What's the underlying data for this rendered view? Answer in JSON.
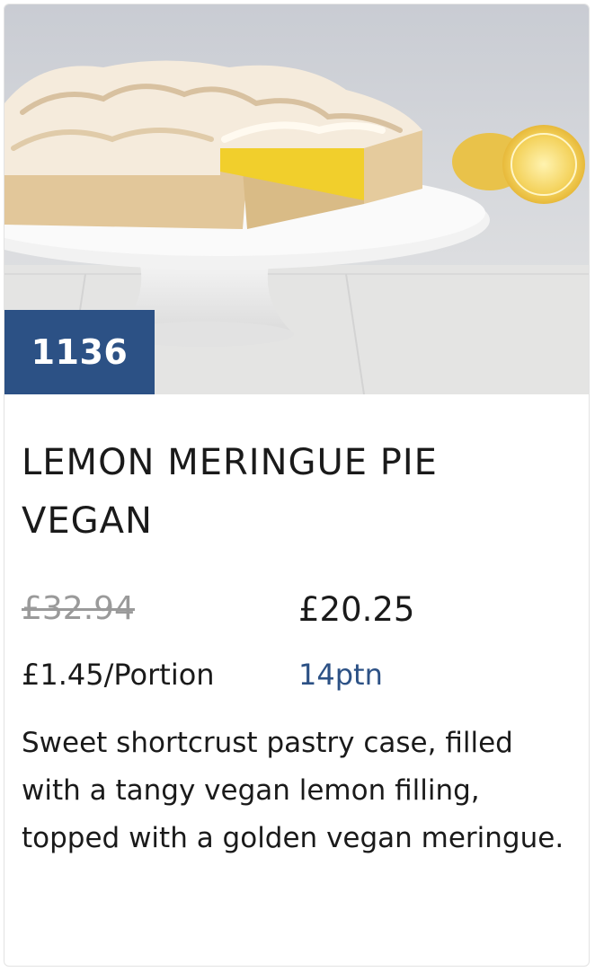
{
  "product": {
    "code": "1136",
    "title": "LEMON MERINGUE PIE VEGAN",
    "image_alt": "Lemon meringue pie on a white cake stand with lemon halves",
    "price_old": "£32.94",
    "price_new": "£20.25",
    "price_per_portion": "£1.45/Portion",
    "portions": "14ptn",
    "description": "Sweet shortcrust pastry case, filled with a tangy vegan lemon filling, topped with a golden vegan meringue."
  },
  "colors": {
    "badge": "#2c5185",
    "portions_text": "#2c5185",
    "old_price_text": "#9a9a9a"
  }
}
